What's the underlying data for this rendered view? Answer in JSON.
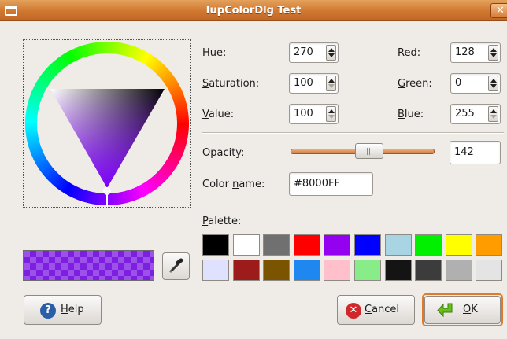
{
  "window": {
    "title": "IupColorDlg Test"
  },
  "hsv": {
    "hue_label": "Hue:",
    "hue_value": "270",
    "saturation_label": "Saturation:",
    "saturation_value": "100",
    "value_label": "Value:",
    "value_value": "100"
  },
  "rgb": {
    "red_label": "Red:",
    "red_value": "128",
    "green_label": "Green:",
    "green_value": "0",
    "blue_label": "Blue:",
    "blue_value": "255"
  },
  "opacity": {
    "label": "Opacity:",
    "value": "142",
    "fraction": 0.557
  },
  "color_name": {
    "label": "Color name:",
    "value": "#8000FF"
  },
  "palette": {
    "label": "Palette:",
    "colors": [
      "#000000",
      "#ffffff",
      "#707070",
      "#ff0000",
      "#9400f0",
      "#0000ff",
      "#a8d4e4",
      "#00f000",
      "#ffff00",
      "#ff9c00",
      "#e0e0ff",
      "#9c1c1c",
      "#7a5400",
      "#1e88f0",
      "#ffc0cc",
      "#88ec88",
      "#141414",
      "#3c3c3c",
      "#b0b0b0",
      "#e4e4e4"
    ]
  },
  "current_color": "#8000FF",
  "buttons": {
    "help": "Help",
    "cancel": "Cancel",
    "ok": "OK"
  },
  "icons": [
    "menu-icon",
    "close-icon",
    "eyedropper-icon",
    "help-icon",
    "cancel-icon",
    "ok-icon"
  ]
}
